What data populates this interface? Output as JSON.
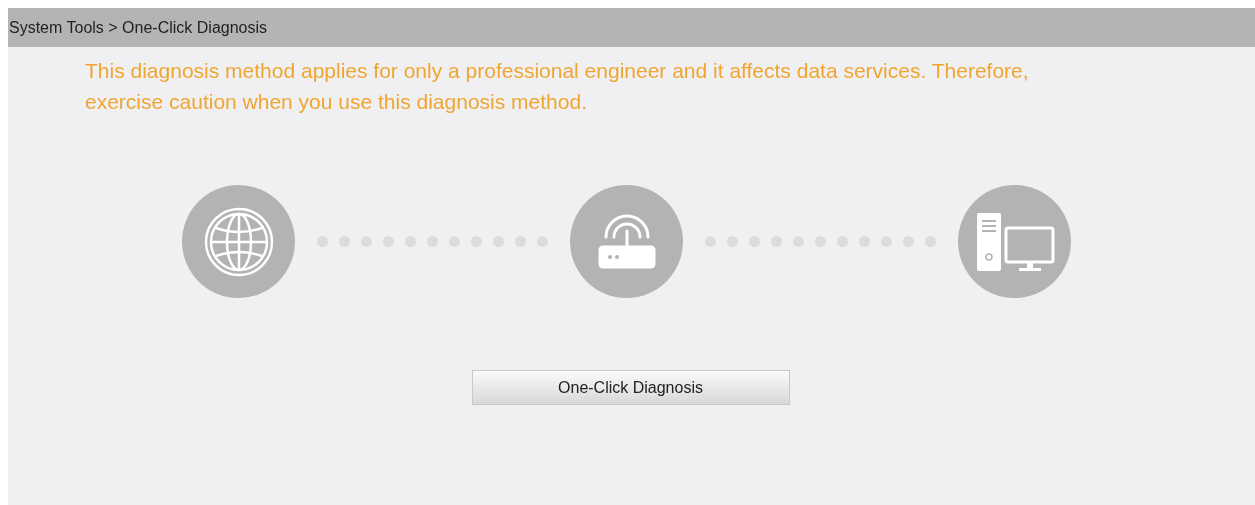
{
  "breadcrumb": "System Tools > One-Click Diagnosis",
  "warning": "This diagnosis method applies for only a professional engineer and it affects data services. Therefore, exercise caution when you use this diagnosis method.",
  "nodes": [
    {
      "kind": "internet"
    },
    {
      "kind": "router"
    },
    {
      "kind": "computer"
    }
  ],
  "button": "One-Click Diagnosis"
}
